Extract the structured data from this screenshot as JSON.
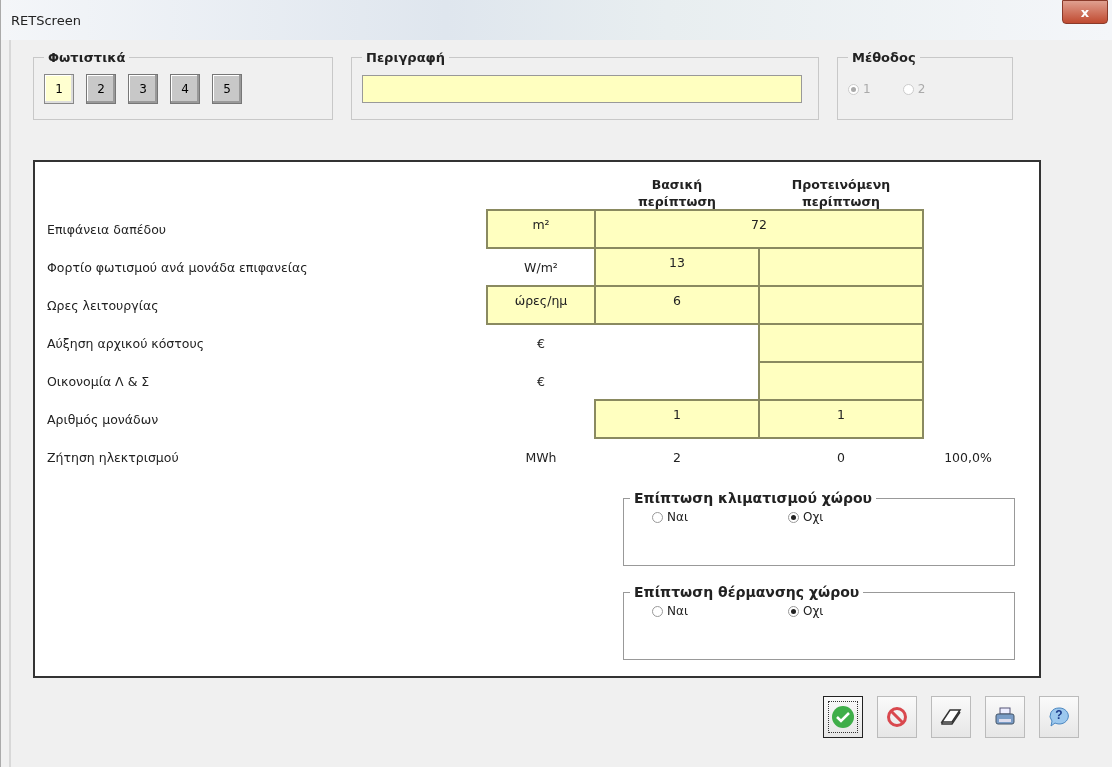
{
  "window": {
    "title": "RETScreen",
    "close": "x"
  },
  "fixtures": {
    "legend": "Φωτιστικά",
    "tabs": [
      {
        "label": "1",
        "selected": true
      },
      {
        "label": "2",
        "selected": false
      },
      {
        "label": "3",
        "selected": false
      },
      {
        "label": "4",
        "selected": false
      },
      {
        "label": "5",
        "selected": false
      }
    ]
  },
  "description": {
    "legend": "Περιγραφή"
  },
  "method": {
    "legend": "Μέθοδος",
    "disabled": true,
    "options": [
      {
        "label": "1",
        "selected": true
      },
      {
        "label": "2",
        "selected": false
      }
    ]
  },
  "table": {
    "columns": [
      "Βασική περίπτωση",
      "Προτεινόμενη περίπτωση"
    ],
    "rows": [
      {
        "label": "Επιφάνεια δαπέδου",
        "unit": {
          "text": "m²",
          "boxed": true
        },
        "base": {
          "kind": "merged",
          "text": "72"
        }
      },
      {
        "label": "Φορτίο φωτισμού ανά μονάδα επιφανείας",
        "unit": {
          "text": "W/m²",
          "boxed": false
        },
        "base": {
          "kind": "input",
          "text": "13"
        },
        "proposed": {
          "kind": "input"
        }
      },
      {
        "label": "Ωρες λειτουργίας",
        "unit": {
          "text": "ώρες/ημ",
          "boxed": true
        },
        "base": {
          "kind": "input",
          "text": "6"
        },
        "proposed": {
          "kind": "input"
        }
      },
      {
        "label": "Αύξηση αρχικού κόστους",
        "unit": {
          "text": "€",
          "boxed": false
        },
        "base": {
          "kind": "none"
        },
        "proposed": {
          "kind": "input"
        }
      },
      {
        "label": "Οικονομία Λ & Σ",
        "unit": {
          "text": "€",
          "boxed": false
        },
        "base": {
          "kind": "none"
        },
        "proposed": {
          "kind": "input"
        }
      },
      {
        "label": "Αριθμός μονάδων",
        "base": {
          "kind": "input",
          "text": "1"
        },
        "proposed": {
          "kind": "input",
          "text": "1"
        }
      },
      {
        "label": "Ζήτηση ηλεκτρισμού",
        "unit": {
          "text": "MWh",
          "boxed": false
        },
        "base": {
          "kind": "text",
          "text": "2"
        },
        "proposed": {
          "kind": "text",
          "text": "0"
        },
        "extra": "100,0%"
      }
    ]
  },
  "impacts": [
    {
      "title": "Επίπτωση κλιματισμού χώρου",
      "options": [
        {
          "label": "Ναι",
          "selected": false
        },
        {
          "label": "Οχι",
          "selected": true
        }
      ]
    },
    {
      "title": "Επίπτωση θέρμανσης χώρου",
      "options": [
        {
          "label": "Ναι",
          "selected": false
        },
        {
          "label": "Οχι",
          "selected": true
        }
      ]
    }
  ],
  "footer_buttons": [
    {
      "kind": "ok",
      "focused": true
    },
    {
      "kind": "cancel",
      "focused": false
    },
    {
      "kind": "erase",
      "focused": false
    },
    {
      "kind": "print",
      "focused": false
    },
    {
      "kind": "help",
      "focused": false,
      "glyph": "?"
    }
  ]
}
